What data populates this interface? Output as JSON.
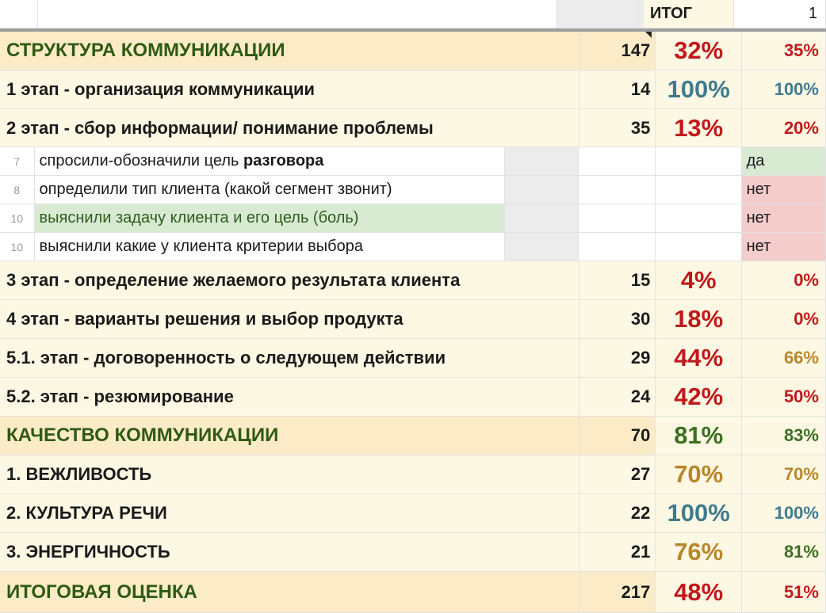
{
  "header": {
    "total_label": "ИТОГ",
    "total_value": "1"
  },
  "rows": [
    {
      "title": "СТРУКТУРА КОММУНИКАЦИИ",
      "score": "147",
      "pct": "32%",
      "final": "35%"
    },
    {
      "title": "1 этап - организация коммуникации",
      "score": "14",
      "pct": "100%",
      "final": "100%"
    },
    {
      "title": "2 этап - сбор информации/ понимание проблемы",
      "score": "35",
      "pct": "13%",
      "final": "20%"
    },
    {
      "num": "7",
      "question_plain": "спросили-обозначили цель ",
      "question_bold": "разговора",
      "answer": "да"
    },
    {
      "num": "8",
      "question": "определили тип клиента (какой сегмент звонит)",
      "answer": "нет"
    },
    {
      "num": "10",
      "question": "выяснили задачу клиента и его цель (боль)",
      "answer": "нет"
    },
    {
      "num": "10",
      "question": "выяснили какие у клиента критерии выбора",
      "answer": "нет"
    },
    {
      "title": "3 этап - определение желаемого результата клиента",
      "score": "15",
      "pct": "4%",
      "final": "0%"
    },
    {
      "title": "4 этап - варианты решения и выбор продукта",
      "score": "30",
      "pct": "18%",
      "final": "0%"
    },
    {
      "title": "5.1. этап - договоренность о следующем действии",
      "score": "29",
      "pct": "44%",
      "final": "66%"
    },
    {
      "title": "5.2. этап - резюмирование",
      "score": "24",
      "pct": "42%",
      "final": "50%"
    },
    {
      "title": "КАЧЕСТВО КОММУНИКАЦИИ",
      "score": "70",
      "pct": "81%",
      "final": "83%"
    },
    {
      "title": "1. ВЕЖЛИВОСТЬ",
      "score": "27",
      "pct": "70%",
      "final": "70%"
    },
    {
      "title": "2. КУЛЬТУРА РЕЧИ",
      "score": "22",
      "pct": "100%",
      "final": "100%"
    },
    {
      "title": "3. ЭНЕРГИЧНОСТЬ",
      "score": "21",
      "pct": "76%",
      "final": "81%"
    },
    {
      "title": "ИТОГОВАЯ ОЦЕНКА",
      "score": "217",
      "pct": "48%",
      "final": "51%"
    }
  ],
  "colors": {
    "red": "#c0191b",
    "teal": "#3f7c8e",
    "gold": "#b8862b",
    "green": "#3c6f22",
    "section_bg": "#fcebc7",
    "row_bg": "#fdf8e4",
    "yes_bg": "#d9ead3",
    "no_bg": "#f4cccc"
  }
}
